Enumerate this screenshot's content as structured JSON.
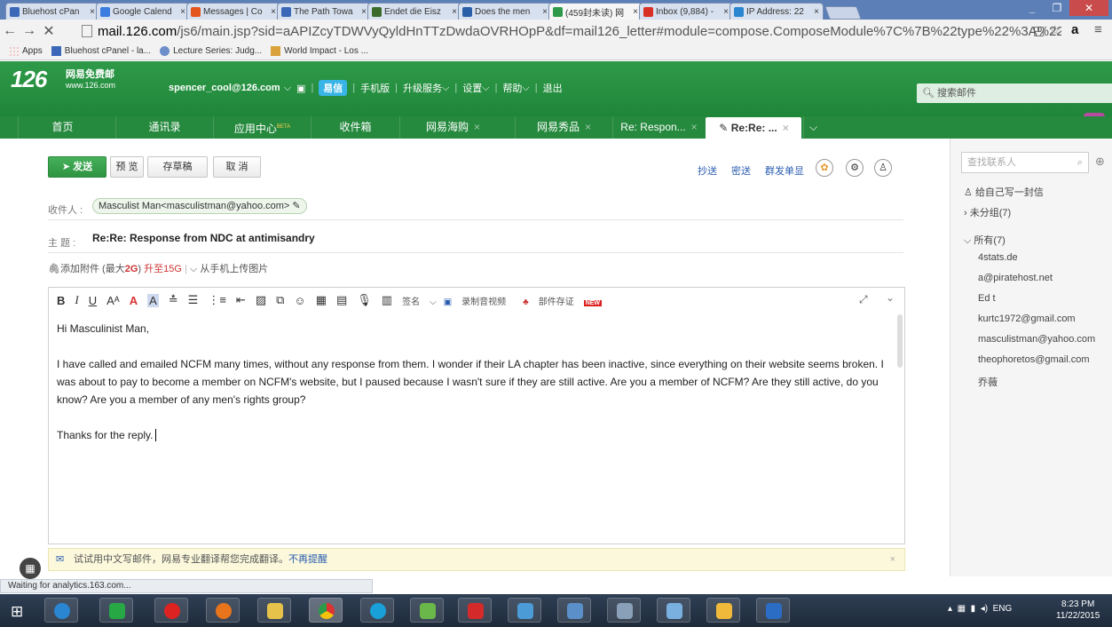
{
  "browser": {
    "tabs": [
      {
        "title": "Bluehost cPan",
        "color": "#3b67b8"
      },
      {
        "title": "Google Calend",
        "color": "#3b7de0"
      },
      {
        "title": "Messages | Co",
        "color": "#e4551c"
      },
      {
        "title": "The Path Towa",
        "color": "#3b67b8"
      },
      {
        "title": "Endet die Eisz",
        "color": "#3a6b2a"
      },
      {
        "title": "Does the men",
        "color": "#2a5fa8"
      },
      {
        "title": "(459封未读) 网",
        "color": "#2e9a49"
      },
      {
        "title": "Inbox (9,884) -",
        "color": "#d93025"
      },
      {
        "title": "IP Address: 22",
        "color": "#2a86d1"
      }
    ],
    "active_tab_index": 6,
    "url_host": "mail.126.com",
    "url_rest": "/js6/main.jsp?sid=aAPIZcyTDWVyQyldHnTTzDwdaOVRHOpP&df=mail126_letter#module=compose.ComposeModule%7C%7B%22type%22%3A%22",
    "bookmarks": [
      "Apps",
      "Bluehost cPanel - la...",
      "Lecture Series: Judg...",
      "World Impact - Los ..."
    ]
  },
  "mail": {
    "logo": "126",
    "logo_line1": "网易免费邮",
    "logo_line2": "www.126.com",
    "user": "spencer_cool@126.com",
    "yixin": "易信",
    "toplinks": [
      "手机版",
      "升级服务",
      "设置",
      "帮助",
      "退出"
    ],
    "search_placeholder": "搜索邮件",
    "nav_tabs": [
      {
        "label": "首页",
        "closable": false
      },
      {
        "label": "通讯录",
        "closable": false
      },
      {
        "label": "应用中心",
        "closable": false,
        "badge": "BETA"
      },
      {
        "label": "收件箱",
        "closable": false
      },
      {
        "label": "网易海购",
        "closable": true
      },
      {
        "label": "网易秀品",
        "closable": true
      },
      {
        "label": "Re: Respon...",
        "closable": true
      },
      {
        "label": "Re:Re: ...",
        "closable": true
      }
    ],
    "more_dots": "•••"
  },
  "compose": {
    "send": "发送",
    "preview": "预 览",
    "save_draft": "存草稿",
    "cancel": "取 消",
    "cc": "抄送",
    "bcc": "密送",
    "group_send": "群发单显",
    "to_label": "收件人 :",
    "recipient": "Masculist Man<masculistman@yahoo.com>",
    "subject_label": "主   题 :",
    "subject": "Re:Re: Response from NDC at antimisandry",
    "attach": "添加附件",
    "attach_max_pre": "(最大",
    "attach_max": "2G",
    "attach_max_post": ")",
    "upgrade": "升至15G",
    "mobile_upload": "从手机上传图片",
    "toolbar_signature": "签名",
    "toolbar_record": "录制音视频",
    "toolbar_proof": "部件存证",
    "toolbar_new": "NEW",
    "greeting": "Hi Masculinist Man,",
    "paragraph": "I have called and emailed NCFM many times, without any response from them. I wonder if their LA chapter has been inactive, since everything on their website seems broken. I was about to pay to become a member on NCFM's  website, but I paused because I wasn't sure if they are still active. Are you a member of NCFM? Are they still active, do you know? Are you a member of any men's rights group?",
    "closing": "Thanks for the reply.",
    "tip": "试试用中文写邮件，网易专业翻译帮您完成翻译。",
    "tip_noremind": "不再提醒"
  },
  "contacts": {
    "search_placeholder": "查找联系人",
    "write_self": "给自己写一封信",
    "ungrouped": "未分组(7)",
    "all": "所有(7)",
    "items": [
      "4stats.de",
      "a@piratehost.net",
      "Ed t",
      "kurtc1972@gmail.com",
      "masculistman@yahoo.com",
      "theophoretos@gmail.com",
      "乔薇"
    ]
  },
  "status": "Waiting for analytics.163.com...",
  "taskbar": {
    "lang": "ENG",
    "time": "8:23 PM",
    "date": "11/22/2015"
  }
}
